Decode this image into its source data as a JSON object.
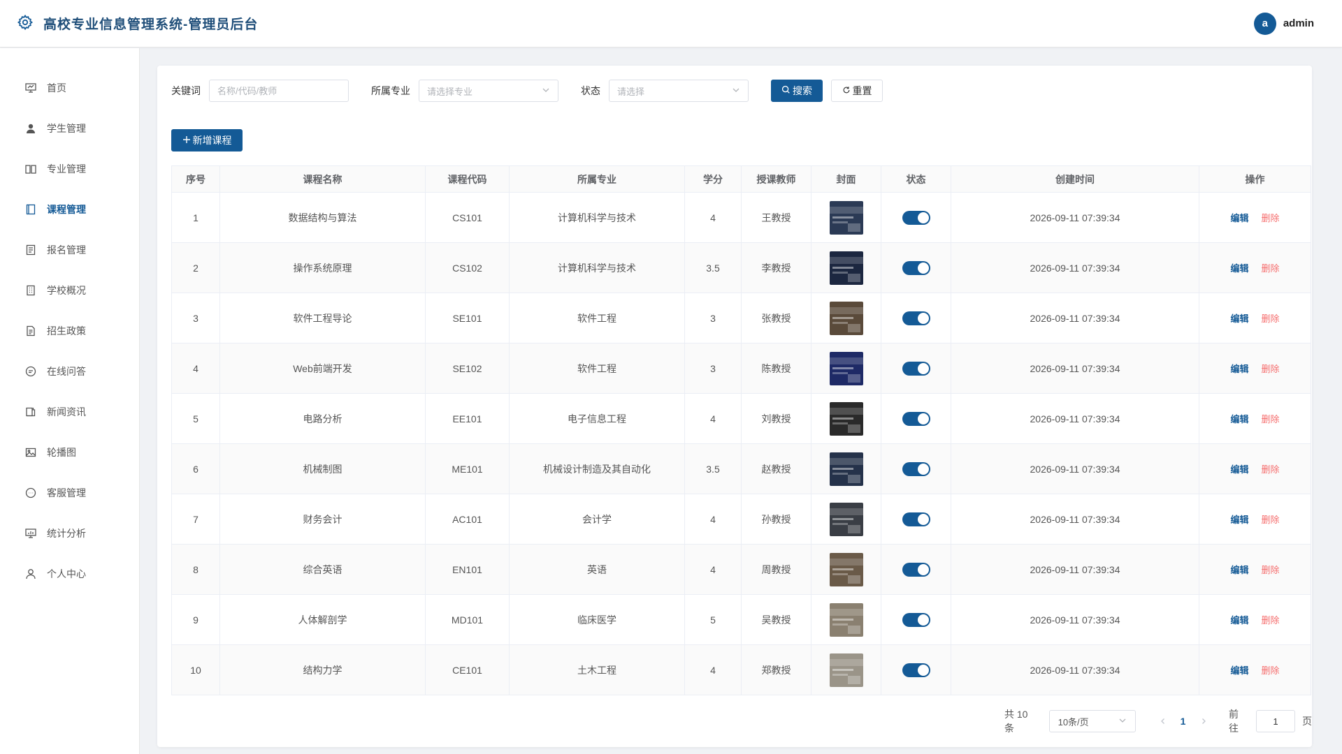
{
  "header": {
    "title": "高校专业信息管理系统-管理员后台",
    "avatar_letter": "a",
    "username": "admin"
  },
  "sidebar": {
    "items": [
      {
        "label": "首页",
        "icon": "presentation-icon",
        "active": false
      },
      {
        "label": "学生管理",
        "icon": "user-icon",
        "active": false
      },
      {
        "label": "专业管理",
        "icon": "book-open-icon",
        "active": false
      },
      {
        "label": "课程管理",
        "icon": "notebook-icon",
        "active": true
      },
      {
        "label": "报名管理",
        "icon": "document-icon",
        "active": false
      },
      {
        "label": "学校概况",
        "icon": "building-icon",
        "active": false
      },
      {
        "label": "招生政策",
        "icon": "file-text-icon",
        "active": false
      },
      {
        "label": "在线问答",
        "icon": "chat-icon",
        "active": false
      },
      {
        "label": "新闻资讯",
        "icon": "news-icon",
        "active": false
      },
      {
        "label": "轮播图",
        "icon": "image-icon",
        "active": false
      },
      {
        "label": "客服管理",
        "icon": "service-chat-icon",
        "active": false
      },
      {
        "label": "统计分析",
        "icon": "chart-board-icon",
        "active": false
      },
      {
        "label": "个人中心",
        "icon": "person-icon",
        "active": false
      }
    ]
  },
  "filters": {
    "keyword_label": "关键词",
    "keyword_placeholder": "名称/代码/教师",
    "major_label": "所属专业",
    "major_placeholder": "请选择专业",
    "status_label": "状态",
    "status_placeholder": "请选择",
    "search_label": "搜索",
    "reset_label": "重置"
  },
  "toolbar": {
    "add_label": "新增课程"
  },
  "table": {
    "headers": [
      "序号",
      "课程名称",
      "课程代码",
      "所属专业",
      "学分",
      "授课教师",
      "封面",
      "状态",
      "创建时间",
      "操作"
    ],
    "edit_label": "编辑",
    "delete_label": "删除",
    "rows": [
      {
        "no": "1",
        "name": "数据结构与算法",
        "code": "CS101",
        "major": "计算机科学与技术",
        "credit": "4",
        "teacher": "王教授",
        "cover_color": "#2b3a55",
        "status_on": true,
        "created": "2026-09-11 07:39:34"
      },
      {
        "no": "2",
        "name": "操作系统原理",
        "code": "CS102",
        "major": "计算机科学与技术",
        "credit": "3.5",
        "teacher": "李教授",
        "cover_color": "#1c2740",
        "status_on": true,
        "created": "2026-09-11 07:39:34"
      },
      {
        "no": "3",
        "name": "软件工程导论",
        "code": "SE101",
        "major": "软件工程",
        "credit": "3",
        "teacher": "张教授",
        "cover_color": "#5a4a3a",
        "status_on": true,
        "created": "2026-09-11 07:39:34"
      },
      {
        "no": "4",
        "name": "Web前端开发",
        "code": "SE102",
        "major": "软件工程",
        "credit": "3",
        "teacher": "陈教授",
        "cover_color": "#1e2a66",
        "status_on": true,
        "created": "2026-09-11 07:39:34"
      },
      {
        "no": "5",
        "name": "电路分析",
        "code": "EE101",
        "major": "电子信息工程",
        "credit": "4",
        "teacher": "刘教授",
        "cover_color": "#2a2a2a",
        "status_on": true,
        "created": "2026-09-11 07:39:34"
      },
      {
        "no": "6",
        "name": "机械制图",
        "code": "ME101",
        "major": "机械设计制造及其自动化",
        "credit": "3.5",
        "teacher": "赵教授",
        "cover_color": "#25324a",
        "status_on": true,
        "created": "2026-09-11 07:39:34"
      },
      {
        "no": "7",
        "name": "财务会计",
        "code": "AC101",
        "major": "会计学",
        "credit": "4",
        "teacher": "孙教授",
        "cover_color": "#3a3e45",
        "status_on": true,
        "created": "2026-09-11 07:39:34"
      },
      {
        "no": "8",
        "name": "综合英语",
        "code": "EN101",
        "major": "英语",
        "credit": "4",
        "teacher": "周教授",
        "cover_color": "#6a5a48",
        "status_on": true,
        "created": "2026-09-11 07:39:34"
      },
      {
        "no": "9",
        "name": "人体解剖学",
        "code": "MD101",
        "major": "临床医学",
        "credit": "5",
        "teacher": "吴教授",
        "cover_color": "#8a8070",
        "status_on": true,
        "created": "2026-09-11 07:39:34"
      },
      {
        "no": "10",
        "name": "结构力学",
        "code": "CE101",
        "major": "土木工程",
        "credit": "4",
        "teacher": "郑教授",
        "cover_color": "#9a9488",
        "status_on": true,
        "created": "2026-09-11 07:39:34"
      }
    ]
  },
  "pagination": {
    "total_text": "共 10 条",
    "page_size": "10条/页",
    "current_page": "1",
    "goto_label": "前往",
    "goto_value": "1",
    "page_suffix": "页"
  },
  "colors": {
    "primary": "#145a96",
    "danger": "#f56c6c"
  }
}
